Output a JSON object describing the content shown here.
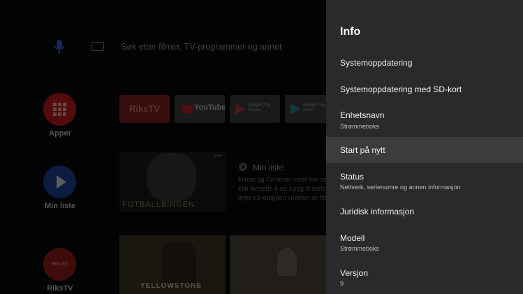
{
  "background": {
    "search_placeholder": "Søk etter filmer, TV-programmer og annet",
    "sidebar": [
      {
        "label": "Apper",
        "icon": "apps-grid-icon",
        "color": "#c62828"
      },
      {
        "label": "Min liste",
        "icon": "play-icon",
        "color": "#1e4fb3"
      },
      {
        "label": "RiksTV",
        "icon": "rikstv-logo-icon",
        "color": "#c62828"
      }
    ],
    "apps": [
      {
        "label": "RiksTV"
      },
      {
        "label": "YouTube"
      },
      {
        "label": "Google Play Movies"
      },
      {
        "label": "Google Play Store"
      }
    ],
    "min_liste": {
      "title": "Min liste",
      "description_lines": [
        "Filmer og TV-serier vises her as",
        "kan fortsette å se. Legg til serie",
        "trykk på knappen i midten av fje"
      ]
    },
    "posters": [
      {
        "label": "FOTBALLBINGEN"
      },
      {
        "label": "YELLOWSTONE"
      }
    ]
  },
  "panel": {
    "title": "Info",
    "items": [
      {
        "title": "Systemoppdatering",
        "subtitle": ""
      },
      {
        "title": "Systemoppdatering med SD-kort",
        "subtitle": ""
      },
      {
        "title": "Enhetsnavn",
        "subtitle": "Strømmeboks"
      },
      {
        "title": "Start på nytt",
        "subtitle": ""
      },
      {
        "title": "Status",
        "subtitle": "Nettverk, serienumre og annen informasjon"
      },
      {
        "title": "Juridisk informasjon",
        "subtitle": ""
      },
      {
        "title": "Modell",
        "subtitle": "Strømmeboks"
      },
      {
        "title": "Versjon",
        "subtitle": "9"
      }
    ]
  }
}
